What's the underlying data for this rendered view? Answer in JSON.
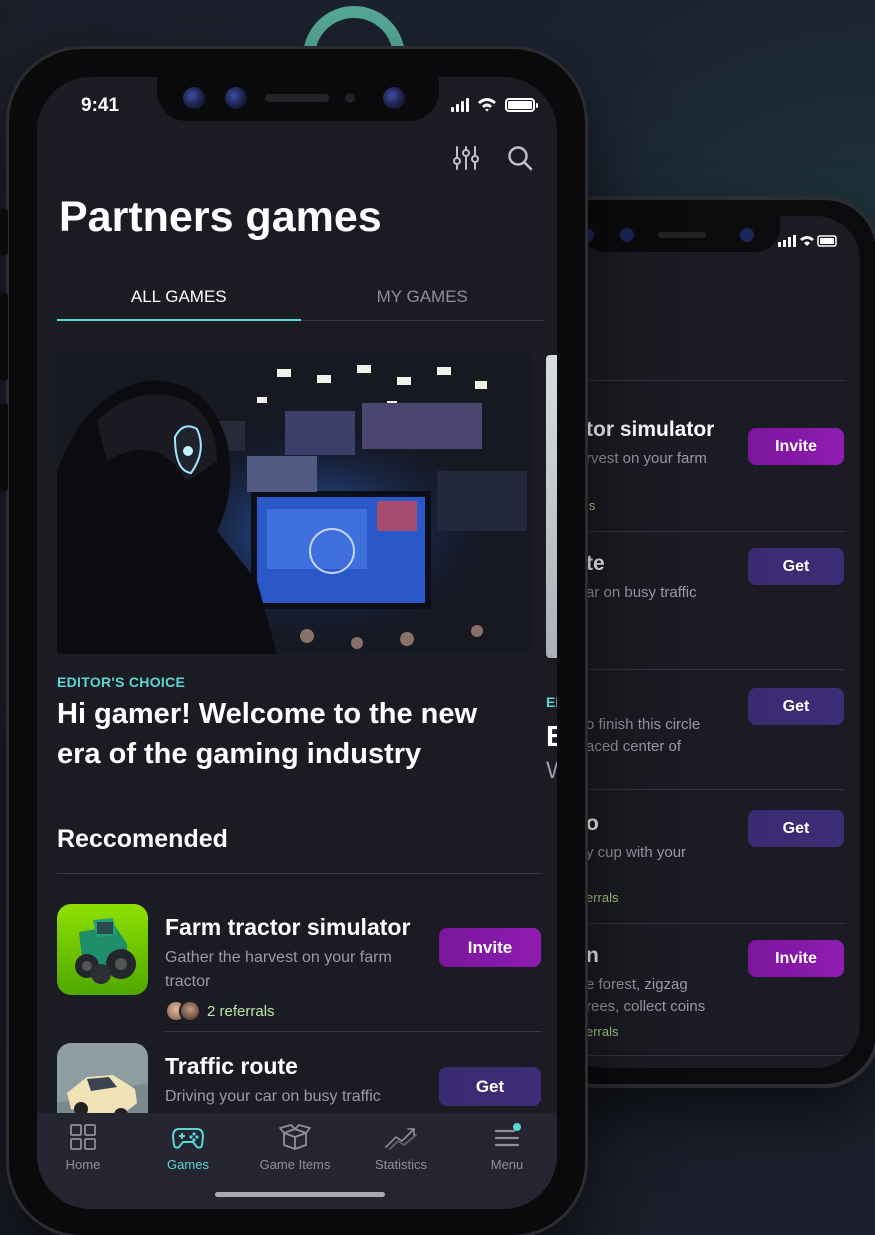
{
  "status": {
    "time": "9:41"
  },
  "header": {
    "title": "Partners games"
  },
  "tabs": [
    {
      "label": "ALL GAMES"
    },
    {
      "label": "MY GAMES"
    }
  ],
  "featured": {
    "tag": "EDITOR'S CHOICE",
    "headline": "Hi gamer! Welcome to the new era of the gaming industry",
    "peek_tag": "ED",
    "peek_headline": "B",
    "peek_sub": "W"
  },
  "recommended": {
    "title": "Reccomended",
    "games": [
      {
        "title": "Farm tractor simulator",
        "desc": "Gather the harvest on your farm tractor",
        "referrals": "2 referrals",
        "action": "Invite"
      },
      {
        "title": "Traffic route",
        "desc": "Driving your car on busy traffic",
        "action": "Get"
      }
    ]
  },
  "tabbar": [
    {
      "label": "Home",
      "icon": "grid-icon"
    },
    {
      "label": "Games",
      "icon": "gamepad-icon"
    },
    {
      "label": "Game Items",
      "icon": "box-icon"
    },
    {
      "label": "Statistics",
      "icon": "chart-icon"
    },
    {
      "label": "Menu",
      "icon": "menu-icon"
    }
  ],
  "back_phone": {
    "rows": [
      {
        "title": "tor simulator",
        "desc": "rvest on your farm",
        "ref": "ls",
        "action": "Invite"
      },
      {
        "title": "te",
        "desc": "ar on busy traffic",
        "action": "Get"
      },
      {
        "desc1": "o finish this circle",
        "desc2": "aced center of",
        "action": "Get"
      },
      {
        "title": "o",
        "desc": "y cup with your",
        "ref": "errals",
        "action": "Get"
      },
      {
        "title": "n",
        "desc1": "e forest, zigzag",
        "desc2": "rees, collect coins",
        "ref": "errals",
        "action": "Invite"
      }
    ]
  },
  "colors": {
    "accent": "#5ad7d3",
    "invite": "#8e1cb0",
    "get": "#3d2d78",
    "background": "#1b1b24"
  }
}
